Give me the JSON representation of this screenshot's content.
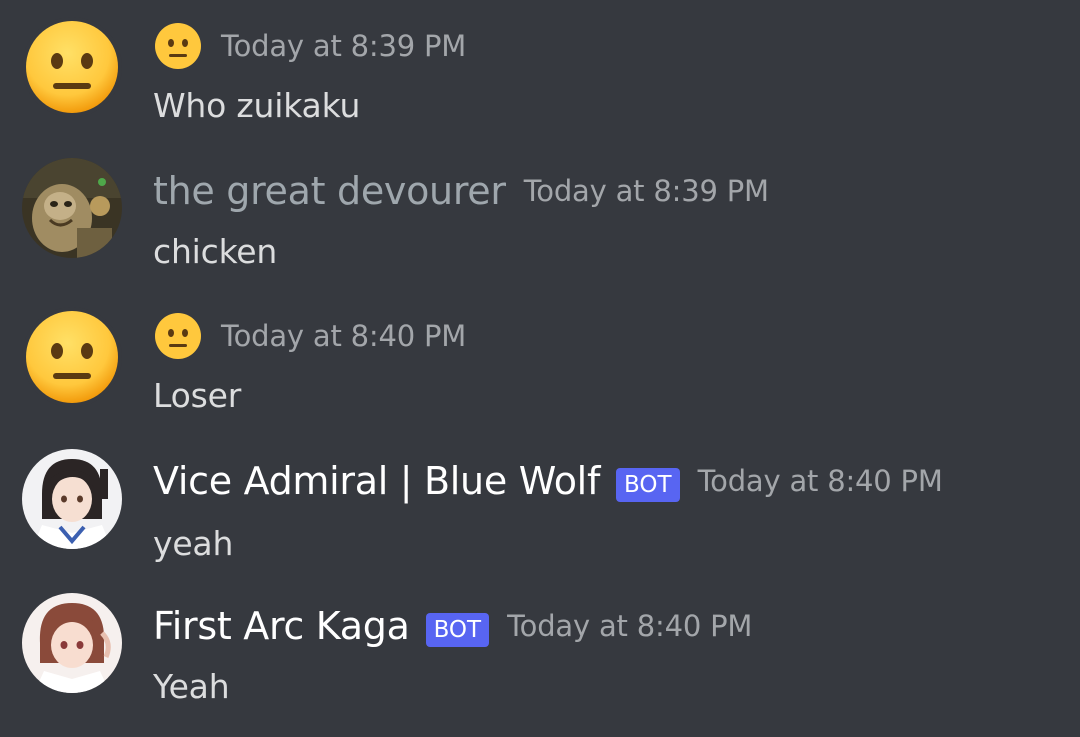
{
  "messages": [
    {
      "author": "",
      "author_icon": "neutral-face-emoji",
      "avatar": "neutral-face-emoji",
      "bot": false,
      "timestamp": "Today at 8:39 PM",
      "content": "Who zuikaku"
    },
    {
      "author": "the great devourer",
      "avatar": "creature-photo-avatar",
      "bot": false,
      "timestamp": "Today at 8:39 PM",
      "content": "chicken"
    },
    {
      "author": "",
      "author_icon": "neutral-face-emoji",
      "avatar": "neutral-face-emoji",
      "bot": false,
      "timestamp": "Today at 8:40 PM",
      "content": "Loser"
    },
    {
      "author": "Vice Admiral | Blue Wolf",
      "avatar": "anime-girl-avatar",
      "bot": true,
      "bot_label": "BOT",
      "timestamp": "Today at 8:40 PM",
      "content": "yeah"
    },
    {
      "author": "First Arc Kaga",
      "avatar": "anime-girl-avatar",
      "bot": true,
      "bot_label": "BOT",
      "timestamp": "Today at 8:40 PM",
      "content": "Yeah"
    }
  ],
  "colors": {
    "background": "#36393f",
    "bot_tag": "#5865f2",
    "timestamp": "#a3a6aa",
    "message_text": "#dcddde",
    "muted_username": "#9fa7ad"
  }
}
